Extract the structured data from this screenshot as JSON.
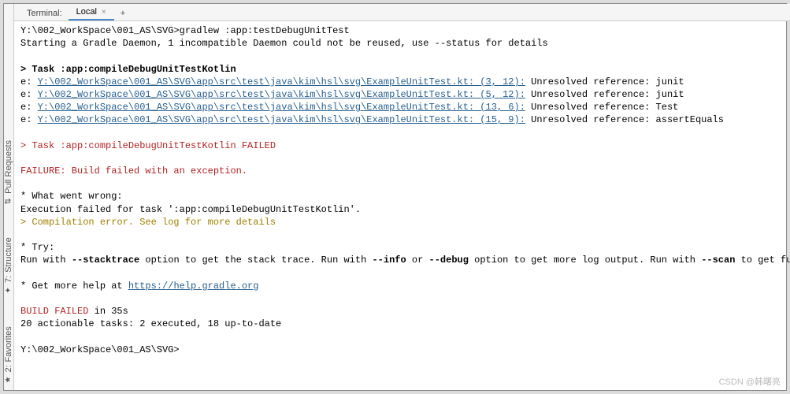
{
  "rail": {
    "pull_requests": "Pull Requests",
    "structure": "Structure",
    "favorites": "Favorites",
    "pull_icon": "⇅",
    "struct_num": "7:",
    "struct_icon": "✦",
    "fav_num": "2:",
    "fav_icon": "★"
  },
  "tabs": {
    "label": "Terminal:",
    "active": "Local",
    "close": "×",
    "add": "+"
  },
  "term": {
    "prompt1": "Y:\\002_WorkSpace\\001_AS\\SVG>",
    "cmd1": "gradlew :app:testDebugUnitTest",
    "line_daemon": "Starting a Gradle Daemon, 1 incompatible Daemon could not be reused, use --status for details",
    "task_header_prefix": "> Task ",
    "task_header_name": ":app:compileDebugUnitTestKotlin",
    "errors": [
      {
        "prefix": "e: ",
        "path": "Y:\\002_WorkSpace\\001_AS\\SVG\\app\\src\\test\\java\\kim\\hsl\\svg\\ExampleUnitTest.kt: (3, 12):",
        "msg": " Unresolved reference: junit"
      },
      {
        "prefix": "e: ",
        "path": "Y:\\002_WorkSpace\\001_AS\\SVG\\app\\src\\test\\java\\kim\\hsl\\svg\\ExampleUnitTest.kt: (5, 12):",
        "msg": " Unresolved reference: junit"
      },
      {
        "prefix": "e: ",
        "path": "Y:\\002_WorkSpace\\001_AS\\SVG\\app\\src\\test\\java\\kim\\hsl\\svg\\ExampleUnitTest.kt: (13, 6):",
        "msg": " Unresolved reference: Test"
      },
      {
        "prefix": "e: ",
        "path": "Y:\\002_WorkSpace\\001_AS\\SVG\\app\\src\\test\\java\\kim\\hsl\\svg\\ExampleUnitTest.kt: (15, 9):",
        "msg": " Unresolved reference: assertEquals"
      }
    ],
    "task_failed": "> Task :app:compileDebugUnitTestKotlin FAILED",
    "failure": "FAILURE: Build failed with an exception.",
    "what_wrong": "* What went wrong:",
    "exec_failed": "Execution failed for task ':app:compileDebugUnitTestKotlin'.",
    "compile_err_prefix": "> ",
    "compile_err": "Compilation error. See log for more details",
    "try": "* Try:",
    "try_line_a": "Run with ",
    "try_stacktrace": "--stacktrace",
    "try_line_b": " option to get the stack trace. Run with ",
    "try_info": "--info",
    "try_line_c": " or ",
    "try_debug": "--debug",
    "try_line_d": " option to get more log output. Run with ",
    "try_scan": "--scan",
    "try_line_e": " to get full insights.",
    "help_prefix": "* Get more help at ",
    "help_url": "https://help.gradle.org",
    "build_failed": "BUILD FAILED",
    "build_time": " in 35s",
    "actionable": "20 actionable tasks: 2 executed, 18 up-to-date",
    "prompt2": "Y:\\002_WorkSpace\\001_AS\\SVG>"
  },
  "watermark": "CSDN @韩曙亮"
}
